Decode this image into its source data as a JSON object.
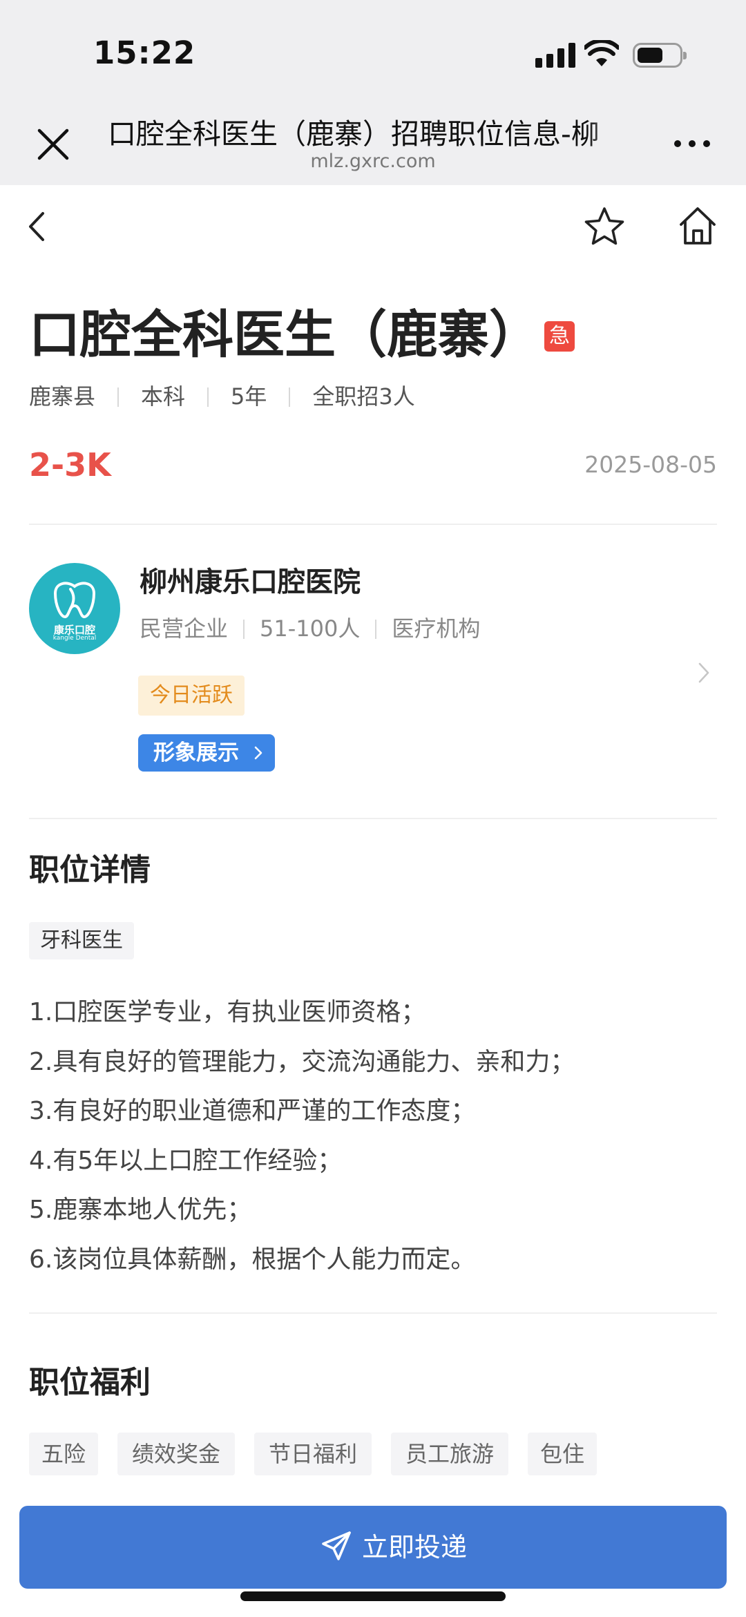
{
  "status_bar": {
    "time": "15:22"
  },
  "browser": {
    "title": "口腔全科医生（鹿寨）招聘职位信息-柳",
    "domain": "mlz.gxrc.com"
  },
  "job": {
    "title": "口腔全科医生（鹿寨）",
    "urgent_badge": "急",
    "meta": [
      "鹿寨县",
      "本科",
      "5年",
      "全职招3人"
    ],
    "salary": "2-3K",
    "date": "2025-08-05"
  },
  "company": {
    "logo_text_cn": "康乐口腔",
    "logo_text_en": "kangle Dental",
    "name": "柳州康乐口腔医院",
    "meta": [
      "民营企业",
      "51-100人",
      "医疗机构"
    ],
    "active_badge": "今日活跃",
    "showcase_label": "形象展示"
  },
  "details": {
    "section_title": "职位详情",
    "tag": "牙科医生",
    "lines": [
      "1.口腔医学专业，有执业医师资格；",
      "2.具有良好的管理能力，交流沟通能力、亲和力；",
      "3.有良好的职业道德和严谨的工作态度；",
      "4.有5年以上口腔工作经验；",
      "5.鹿寨本地人优先；",
      "6.该岗位具体薪酬，根据个人能力而定。"
    ]
  },
  "benefits": {
    "section_title": "职位福利",
    "items": [
      "五险",
      "绩效奖金",
      "节日福利",
      "员工旅游",
      "包住"
    ]
  },
  "cta": {
    "label": "立即投递"
  },
  "colors": {
    "accent": "#4279d4",
    "salary": "#e8524a",
    "urgent": "#ee4a3f",
    "logo": "#27b4c2",
    "active": "#e38b1c"
  },
  "icons": [
    "close-icon",
    "more-icon",
    "back-icon",
    "star-icon",
    "home-icon",
    "chevron-right-icon",
    "send-icon"
  ]
}
